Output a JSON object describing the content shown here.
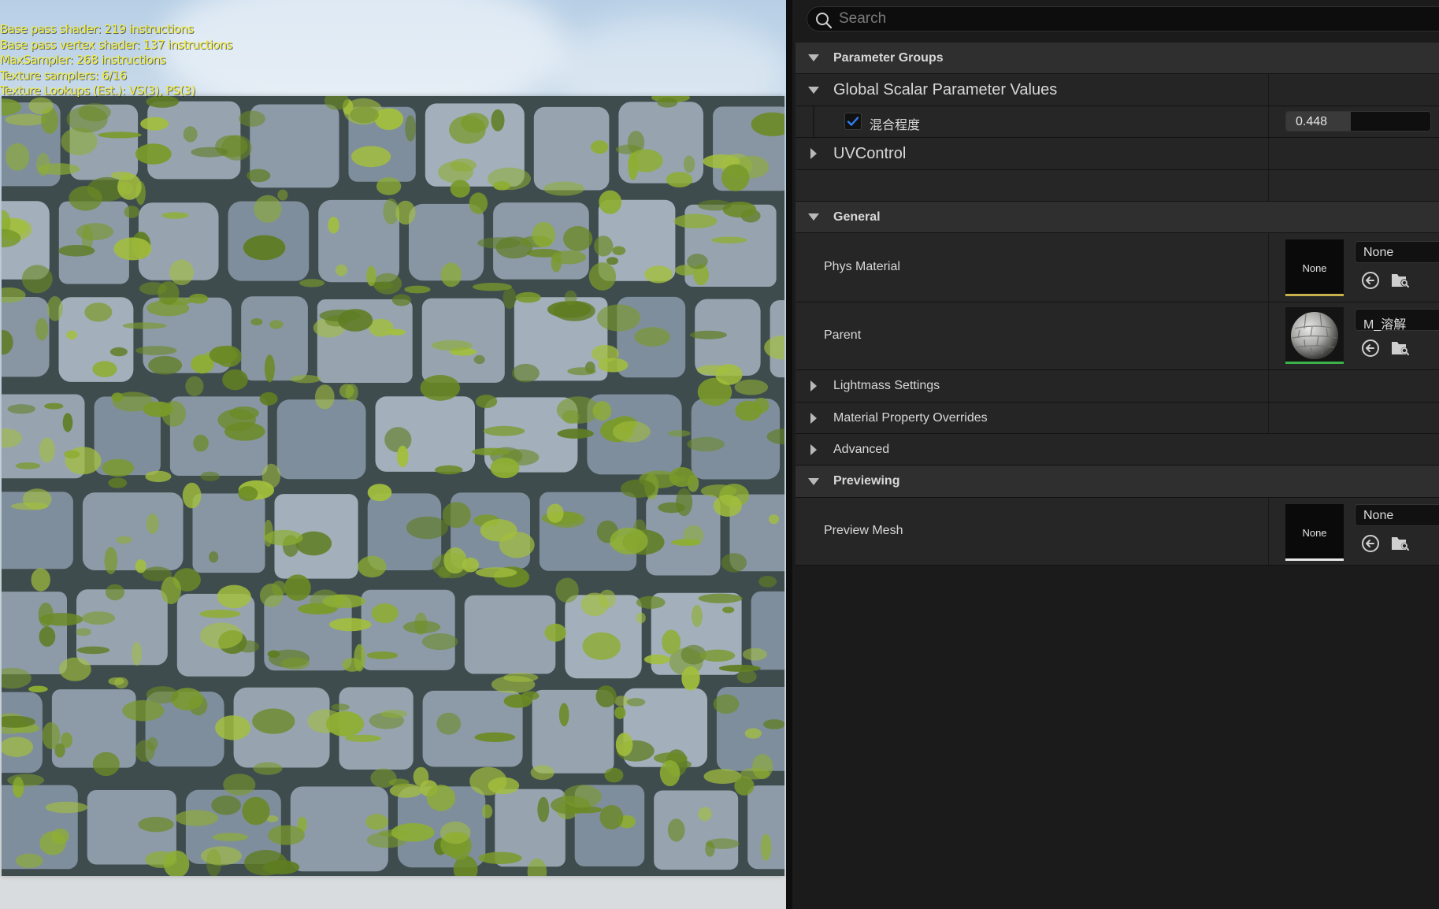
{
  "viewport": {
    "stats": [
      "Base pass shader: 219 instructions",
      "Base pass vertex shader: 137 instructions",
      "MaxSampler: 268 instructions",
      "Texture samplers: 6/16",
      "Texture Lookups (Est.): VS(3), PS(3)"
    ]
  },
  "panel": {
    "search": {
      "placeholder": "Search",
      "value": ""
    },
    "parameter_groups": {
      "label": "Parameter Groups"
    },
    "global_scalar": {
      "label": "Global Scalar Parameter Values",
      "param": {
        "name": "混合程度",
        "checked": true,
        "value": "0.448",
        "fill_fraction": 0.448
      }
    },
    "uvcontrol": {
      "label": "UVControl"
    },
    "general": {
      "label": "General",
      "phys_material": {
        "label": "Phys Material",
        "thumb": "None",
        "value": "None",
        "bar_color": "#c8b14a"
      },
      "parent": {
        "label": "Parent",
        "value": "M_溶解",
        "bar_color": "#3bb34a"
      }
    },
    "lightmass": {
      "label": "Lightmass Settings"
    },
    "overrides": {
      "label": "Material Property Overrides"
    },
    "advanced": {
      "label": "Advanced"
    },
    "previewing": {
      "label": "Previewing",
      "preview_mesh": {
        "label": "Preview Mesh",
        "thumb": "None",
        "value": "None",
        "bar_color": "#e8e8e8"
      }
    }
  },
  "colors": {
    "stats_text": "#f2ee3a",
    "panel_bg": "#1b1b1b",
    "category_bg": "#2f2f2f",
    "checkbox_check": "#2f7ff0"
  }
}
